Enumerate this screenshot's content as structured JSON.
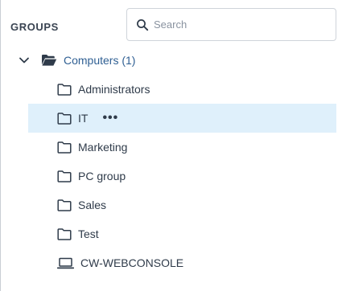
{
  "header": {
    "title": "GROUPS"
  },
  "search": {
    "placeholder": "Search"
  },
  "tree": {
    "root": {
      "label": "Computers (1)",
      "expanded": true
    },
    "groups": [
      {
        "label": "Administrators"
      },
      {
        "label": "IT",
        "selected": true,
        "more": "•••"
      },
      {
        "label": "Marketing"
      },
      {
        "label": "PC group"
      },
      {
        "label": "Sales"
      },
      {
        "label": "Test"
      }
    ],
    "computers": [
      {
        "label": "CW-WEBCONSOLE"
      }
    ]
  },
  "colors": {
    "selected_bg": "#dff0fb",
    "accent_text": "#2f5f93",
    "border": "#cfd4da"
  }
}
